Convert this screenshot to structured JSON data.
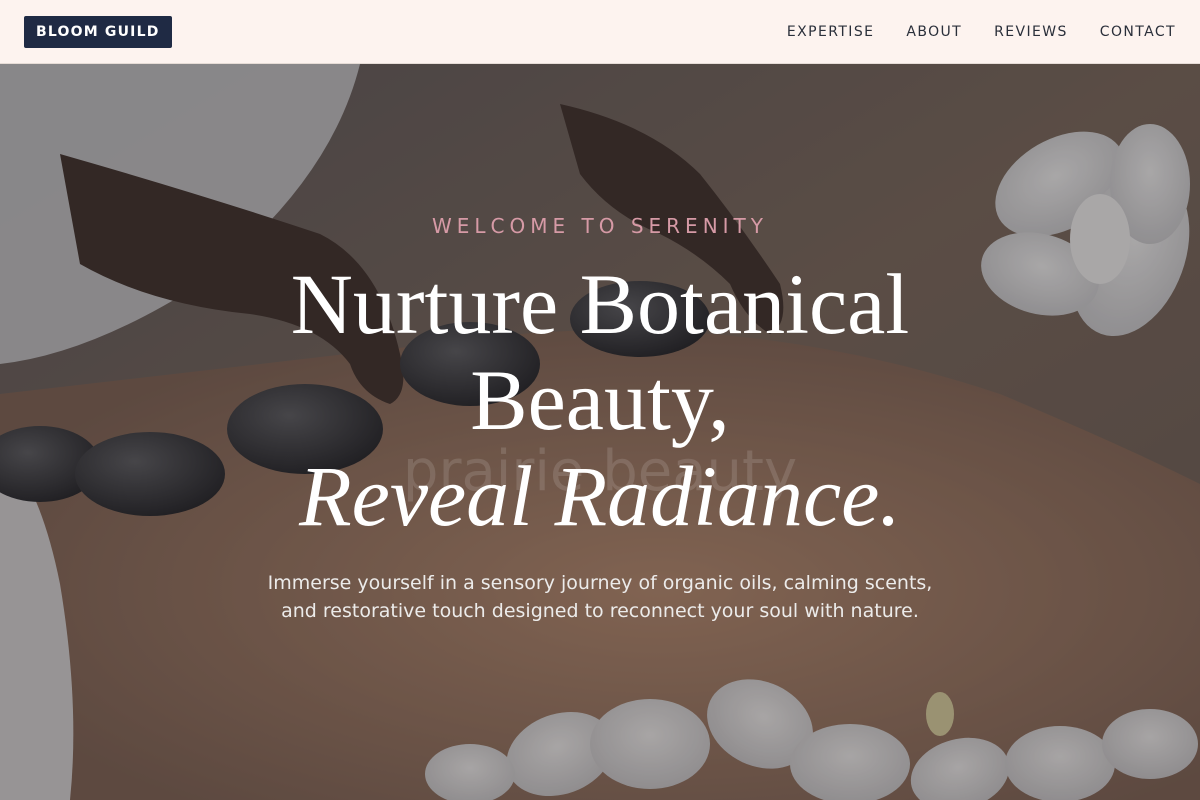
{
  "nav": {
    "brand": "BLOOM GUILD",
    "links": [
      "EXPERTISE",
      "ABOUT",
      "REVIEWS",
      "CONTACT"
    ]
  },
  "hero": {
    "eyebrow": "WELCOME TO SERENITY",
    "headline_line1": "Nurture Botanical",
    "headline_line2": "Beauty,",
    "headline_line3": "Reveal Radiance.",
    "ghost_text": "prairie beauty",
    "description": "Immerse yourself in a sensory journey of organic oils, calming scents, and restorative touch designed to reconnect your soul with nature.",
    "background_image": "spa-hot-stone-massage-with-white-orchids"
  },
  "colors": {
    "nav_background": "#fdf3ef",
    "brand_background": "#1f2a44",
    "eyebrow": "#d69aa6",
    "headline": "#ffffff"
  }
}
